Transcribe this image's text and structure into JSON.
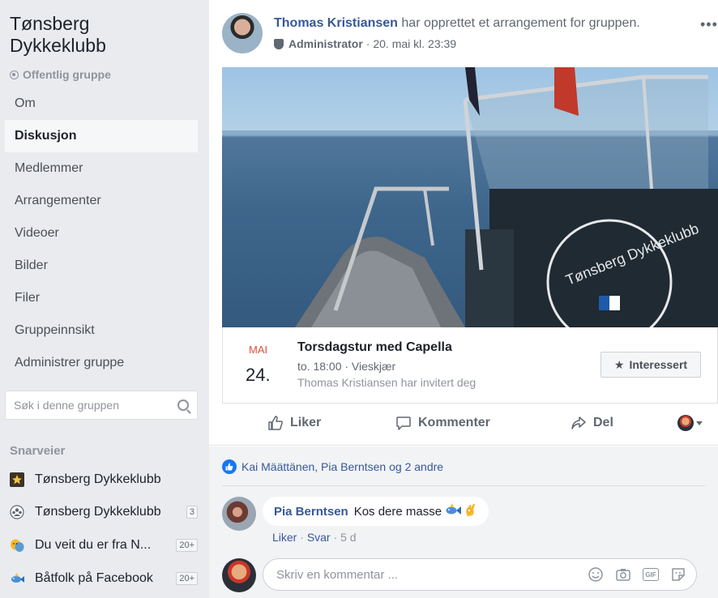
{
  "group": {
    "title": "Tønsberg Dykkeklubb",
    "type": "Offentlig gruppe"
  },
  "nav": {
    "items": [
      {
        "label": "Om"
      },
      {
        "label": "Diskusjon"
      },
      {
        "label": "Medlemmer"
      },
      {
        "label": "Arrangementer"
      },
      {
        "label": "Videoer"
      },
      {
        "label": "Bilder"
      },
      {
        "label": "Filer"
      },
      {
        "label": "Gruppeinnsikt"
      },
      {
        "label": "Administrer gruppe"
      }
    ],
    "active_index": 1
  },
  "search": {
    "placeholder": "Søk i denne gruppen"
  },
  "shortcuts": {
    "title": "Snarveier",
    "items": [
      {
        "label": "Tønsberg Dykkeklubb",
        "badge": "",
        "icon": "star-icon"
      },
      {
        "label": "Tønsberg Dykkeklubb",
        "badge": "3",
        "icon": "group-icon"
      },
      {
        "label": "Du veit du er fra N...",
        "badge": "20+",
        "icon": "masks-icon"
      },
      {
        "label": "Båtfolk på Facebook",
        "badge": "20+",
        "icon": "fish-icon"
      }
    ]
  },
  "post": {
    "author": "Thomas Kristiansen",
    "action": "har opprettet et arrangement for gruppen.",
    "role": "Administrator",
    "date": "· 20. mai kl. 23:39",
    "photo_text": "Tønsberg Dykkeklubb"
  },
  "event": {
    "month": "MAI",
    "day": "24.",
    "title": "Torsdagstur med Capella",
    "time_place": "to. 18:00 · Vieskjær",
    "invited": "Thomas Kristiansen har invitert deg",
    "interested_label": "Interessert"
  },
  "actions": {
    "like": "Liker",
    "comment": "Kommenter",
    "share": "Del"
  },
  "reactions": {
    "text": "Kai Määttänen, Pia Berntsen og 2 andre"
  },
  "comment": {
    "author": "Pia Berntsen",
    "text": "Kos dere masse",
    "like": "Liker",
    "reply": "Svar",
    "age": "5 d"
  },
  "composer": {
    "placeholder": "Skriv en kommentar ..."
  },
  "colors": {
    "link": "#385898",
    "accent": "#1877f2",
    "event_month": "#e04f3e"
  }
}
